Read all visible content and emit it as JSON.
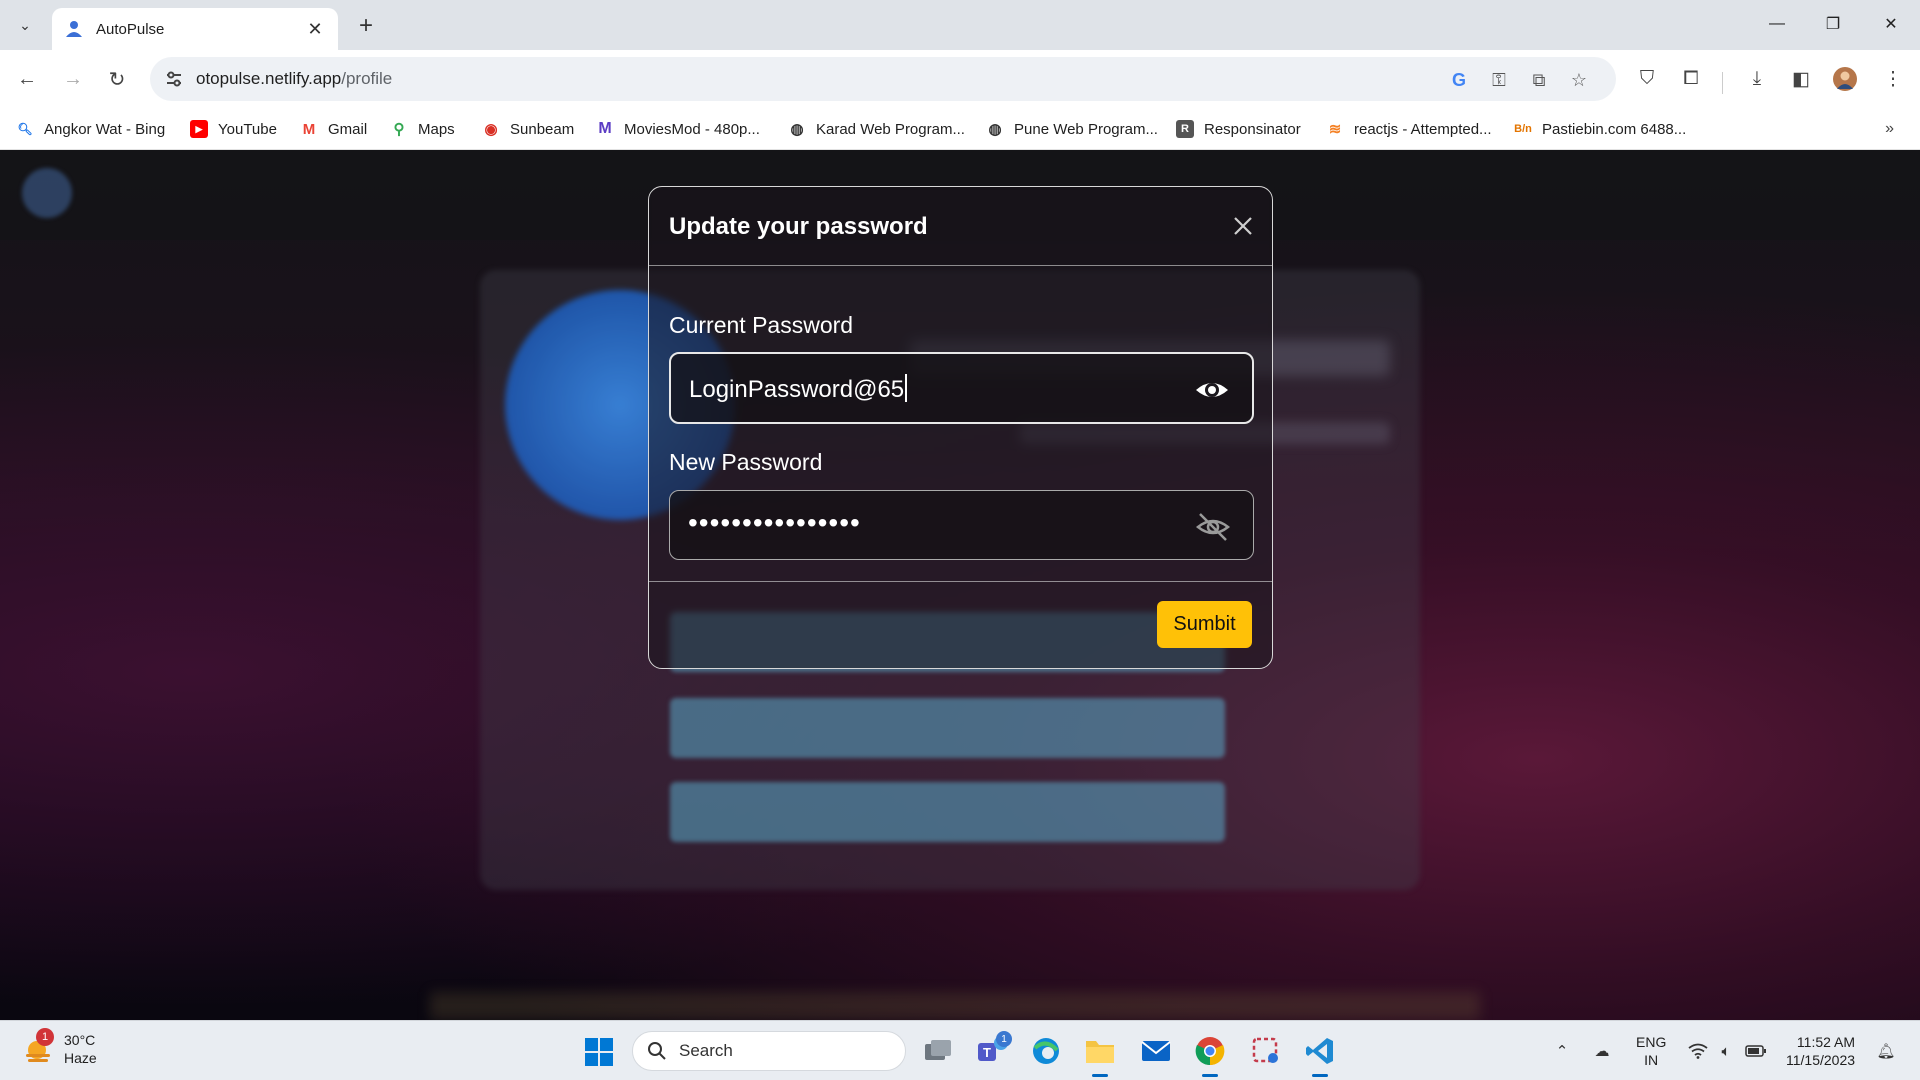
{
  "browser": {
    "tab_title": "AutoPulse",
    "url_host": "otopulse.netlify.app",
    "url_path": "/profile",
    "bookmarks": [
      {
        "label": "Angkor Wat - Bing",
        "icon": "bing-search-icon",
        "color": "#1a73e8"
      },
      {
        "label": "YouTube",
        "icon": "youtube-icon",
        "color": "#ff0000"
      },
      {
        "label": "Gmail",
        "icon": "gmail-icon",
        "color": "#ea4335"
      },
      {
        "label": "Maps",
        "icon": "maps-pin-icon",
        "color": "#34a853"
      },
      {
        "label": "Sunbeam",
        "icon": "sunbeam-icon",
        "color": "#d93025"
      },
      {
        "label": "MoviesMod - 480p...",
        "icon": "moviesmod-icon",
        "color": "#5b3cc4"
      },
      {
        "label": "Karad Web Program...",
        "icon": "globe-icon",
        "color": "#333333"
      },
      {
        "label": "Pune Web Program...",
        "icon": "globe-icon",
        "color": "#333333"
      },
      {
        "label": "Responsinator",
        "icon": "responsinator-icon",
        "color": "#444444"
      },
      {
        "label": "reactjs - Attempted...",
        "icon": "stackoverflow-icon",
        "color": "#f48024"
      },
      {
        "label": "Pastiebin.com 6488...",
        "icon": "pastebin-icon",
        "color": "#e37400"
      }
    ]
  },
  "modal": {
    "title": "Update your password",
    "current_label": "Current Password",
    "current_value": "LoginPassword@65",
    "new_label": "New Password",
    "new_value_masked": "••••••••••••••••",
    "submit_label": "Sumbit"
  },
  "taskbar": {
    "weather_temp": "30°C",
    "weather_desc": "Haze",
    "weather_badge": "1",
    "search_label": "Search",
    "teams_badge": "1",
    "lang_top": "ENG",
    "lang_bottom": "IN",
    "time": "11:52 AM",
    "date": "11/15/2023"
  },
  "colors": {
    "accent_submit": "#ffc107",
    "taskbar_accent": "#0067c0"
  }
}
